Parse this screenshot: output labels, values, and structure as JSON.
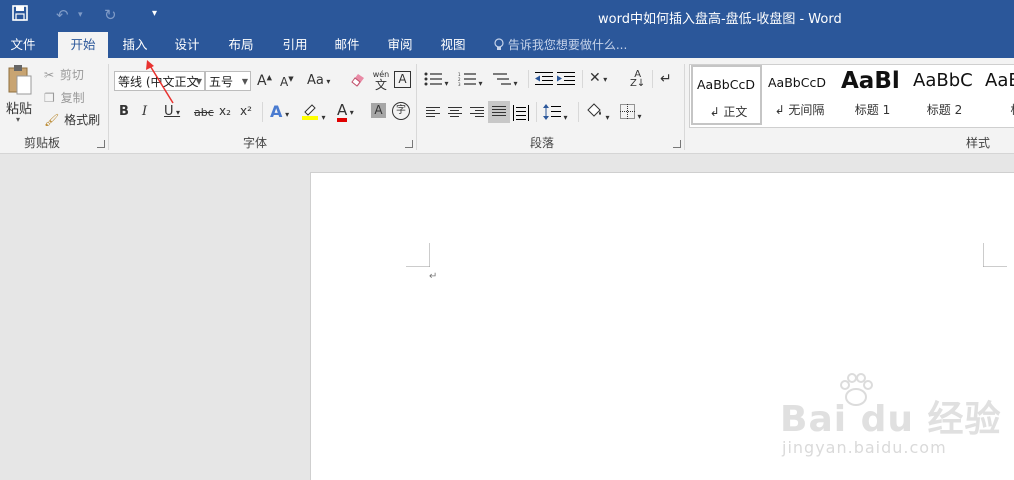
{
  "window": {
    "title": "word中如何插入盘高-盘低-收盘图 - Word",
    "save_icon": "save-icon",
    "undo_icon": "undo-icon",
    "redo_icon": "redo-icon",
    "customize_icon": "customize-qat-icon"
  },
  "tabs": [
    {
      "label": "文件"
    },
    {
      "label": "开始",
      "active": true
    },
    {
      "label": "插入"
    },
    {
      "label": "设计"
    },
    {
      "label": "布局"
    },
    {
      "label": "引用"
    },
    {
      "label": "邮件"
    },
    {
      "label": "审阅"
    },
    {
      "label": "视图"
    }
  ],
  "tell_me": "告诉我您想要做什么...",
  "clipboard": {
    "paste": "粘贴",
    "cut": "剪切",
    "copy": "复制",
    "format_painter": "格式刷",
    "group": "剪贴板"
  },
  "font": {
    "font_name": "等线 (中文正文",
    "font_size": "五号",
    "group": "字体",
    "phonetic": "wén",
    "phonetic_base": "文",
    "aa_label": "Aa",
    "bold": "B",
    "italic": "I",
    "underline": "U",
    "strike": "abc",
    "sub": "x₂",
    "sup": "x²",
    "grow": "A",
    "shrink": "A",
    "text_effects": "A",
    "font_color": "A",
    "char_shading": "A",
    "enclose": "字",
    "char_border": "A"
  },
  "paragraph": {
    "group": "段落"
  },
  "styles": {
    "group": "样式",
    "items": [
      {
        "sample": "AaBbCcD",
        "name": "↲ 正文"
      },
      {
        "sample": "AaBbCcD",
        "name": "↲ 无间隔"
      },
      {
        "sample": "AaBl",
        "name": "标题 1"
      },
      {
        "sample": "AaBbC",
        "name": "标题 2"
      },
      {
        "sample": "AaB",
        "name": "标"
      }
    ]
  },
  "document": {
    "paragraph_mark": "↵"
  },
  "watermark": {
    "logo": "Bai du 经验",
    "url": "jingyan.baidu.com"
  },
  "colors": {
    "brand": "#2b579a",
    "highlight": "#ffff00",
    "font_red": "#e00000",
    "annotation_arrow": "#e8322f"
  }
}
